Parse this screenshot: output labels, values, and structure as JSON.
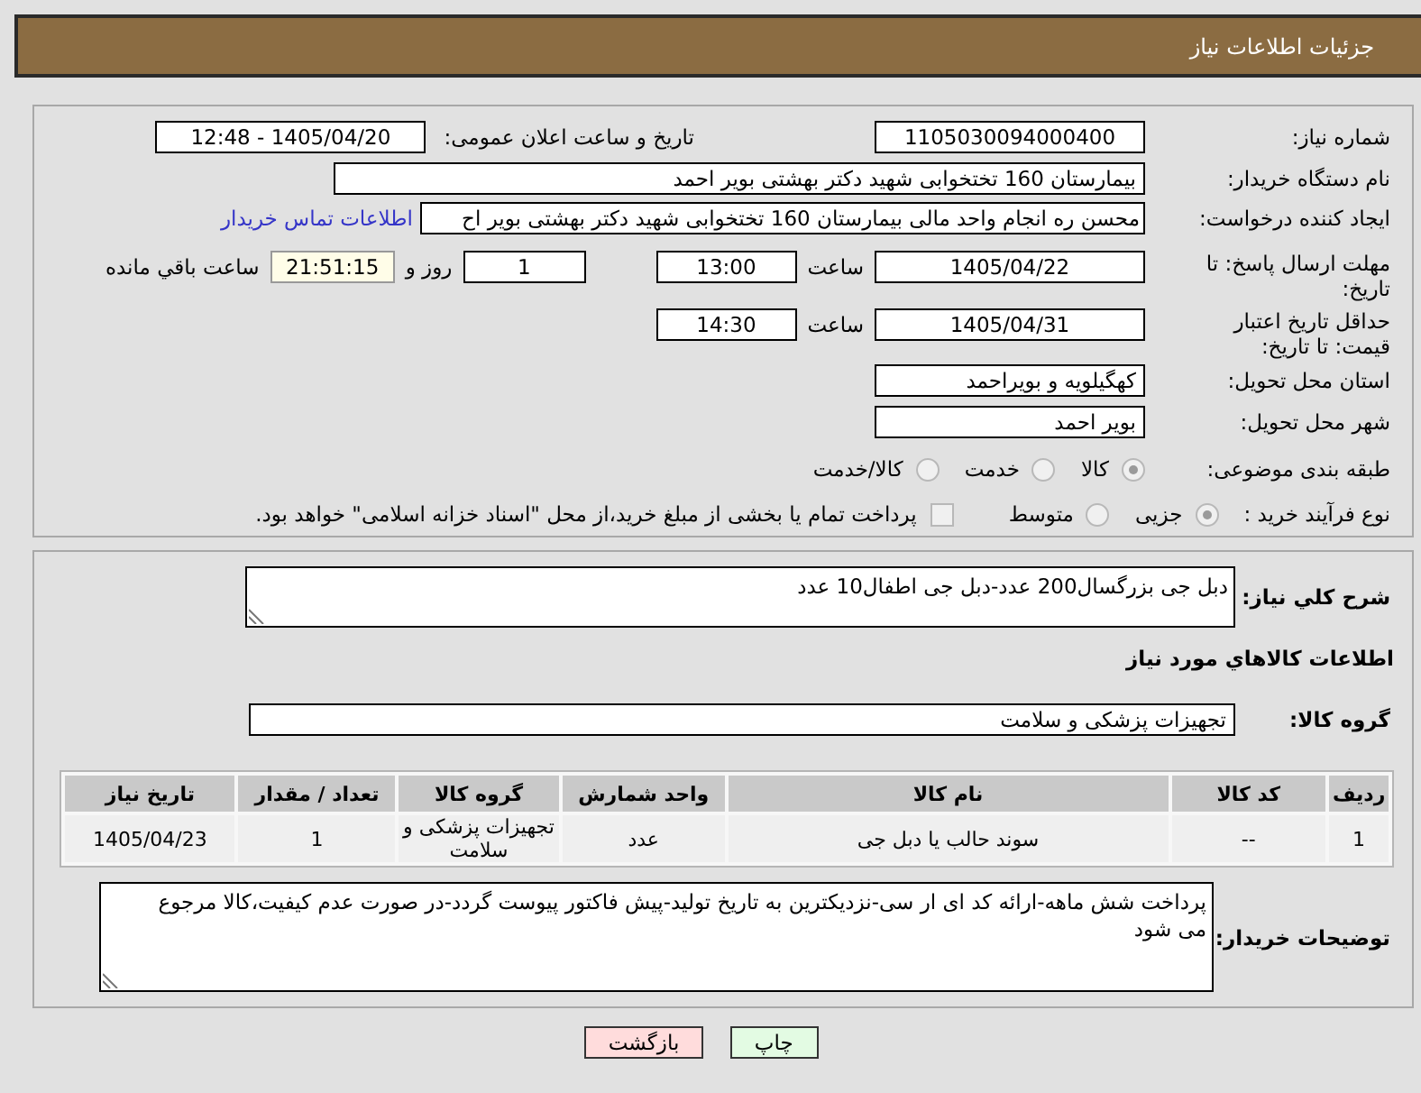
{
  "header": {
    "title": "جزئیات اطلاعات نیاز"
  },
  "details": {
    "need_number": {
      "label": "شماره نیاز:",
      "value": "1105030094000400"
    },
    "announcement": {
      "label": "تاریخ و ساعت اعلان عمومی:",
      "value": "1405/04/20 - 12:48"
    },
    "buyer_org": {
      "label": "نام دستگاه خریدار:",
      "value": "بیمارستان 160 تختخوابی شهید دکتر بهشتی بویر احمد"
    },
    "requester": {
      "label": "ایجاد کننده درخواست:",
      "value": "محسن ره انجام واحد مالی بیمارستان 160 تختخوابی شهید دکتر بهشتی بویر اح",
      "link": "اطلاعات تماس خریدار"
    },
    "response_deadline": {
      "label": "مهلت ارسال پاسخ: تا تاریخ:",
      "date": "1405/04/22",
      "time_label": "ساعت",
      "time": "13:00",
      "days": "1",
      "days_label": "روز و",
      "remaining": "21:51:15",
      "remaining_label": "ساعت باقي مانده"
    },
    "price_validity": {
      "label": "حداقل تاریخ اعتبار قیمت: تا تاریخ:",
      "date": "1405/04/31",
      "time_label": "ساعت",
      "time": "14:30"
    },
    "province": {
      "label": "استان محل تحویل:",
      "value": "کهگیلویه و بویراحمد"
    },
    "city": {
      "label": "شهر محل تحویل:",
      "value": "بویر احمد"
    },
    "category": {
      "label": "طبقه بندی موضوعی:",
      "options": [
        {
          "label": "کالا",
          "selected": true
        },
        {
          "label": "خدمت",
          "selected": false
        },
        {
          "label": "کالا/خدمت",
          "selected": false
        }
      ]
    },
    "process": {
      "label": "نوع فرآیند خرید :",
      "options": [
        {
          "label": "جزیی",
          "selected": true
        },
        {
          "label": "متوسط",
          "selected": false
        }
      ],
      "treasury": {
        "label": "پرداخت تمام یا بخشی از مبلغ خرید،از محل \"اسناد خزانه اسلامی\" خواهد بود.",
        "checked": false
      }
    }
  },
  "description": {
    "label": "شرح کلي نیاز:",
    "value": "دبل جی بزرگسال200 عدد-دبل جی اطفال10 عدد"
  },
  "goods": {
    "title": "اطلاعات کالاهاي مورد نیاز",
    "group_label": "گروه کالا:",
    "group": "تجهیزات پزشکی و سلامت",
    "table": {
      "columns": [
        "ردیف",
        "کد کالا",
        "نام کالا",
        "واحد شمارش",
        "گروه کالا",
        "تعداد / مقدار",
        "تاریخ نیاز"
      ],
      "rows": [
        [
          "1",
          "--",
          "سوند حالب یا دبل جی",
          "عدد",
          "تجهیزات پزشکی و سلامت",
          "1",
          "1405/04/23"
        ]
      ]
    }
  },
  "buyer_notes": {
    "label": "توضیحات خریدار:",
    "value": "پرداخت شش ماهه-ارائه کد ای ار سی-نزدیکترین به تاریخ تولید-پیش فاکتور پیوست گردد-در صورت عدم کیفیت،کالا مرجوع می شود"
  },
  "buttons": [
    {
      "label": "چاپ",
      "kind": "print"
    },
    {
      "label": "بازگشت",
      "kind": "back"
    }
  ]
}
